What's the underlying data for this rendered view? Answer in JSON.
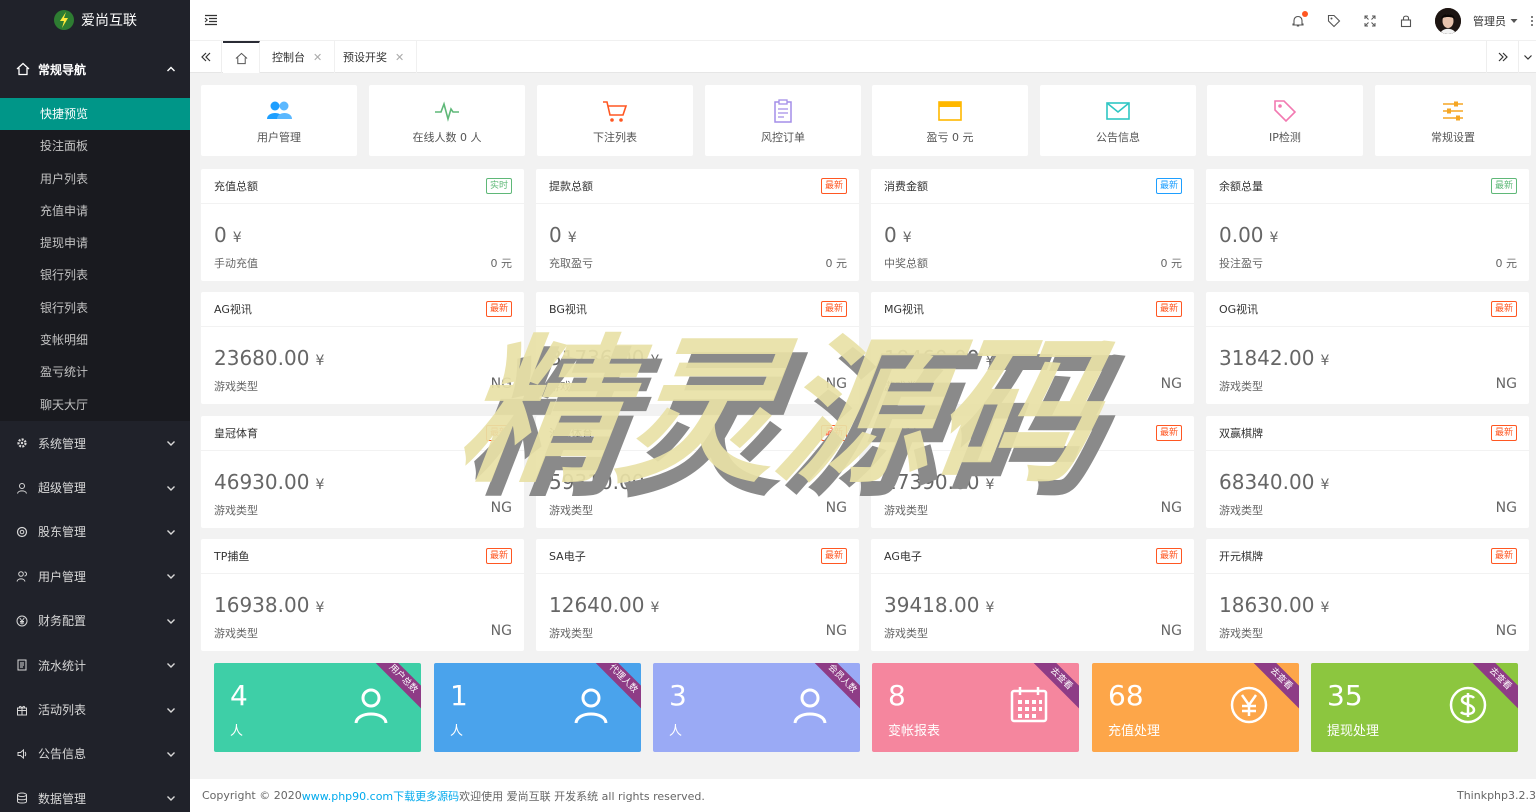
{
  "app": {
    "name": "爱尚互联"
  },
  "sidebar": {
    "group": {
      "label": "常规导航"
    },
    "items": [
      {
        "label": "快捷预览",
        "active": true
      },
      {
        "label": "投注面板"
      },
      {
        "label": "用户列表"
      },
      {
        "label": "充值申请"
      },
      {
        "label": "提现申请"
      },
      {
        "label": "银行列表"
      },
      {
        "label": "银行列表"
      },
      {
        "label": "变帐明细"
      },
      {
        "label": "盈亏统计"
      },
      {
        "label": "聊天大厅"
      }
    ],
    "categories": [
      {
        "label": "系统管理",
        "icon": "gear-icon"
      },
      {
        "label": "超级管理",
        "icon": "user-icon"
      },
      {
        "label": "股东管理",
        "icon": "settings-icon"
      },
      {
        "label": "用户管理",
        "icon": "users-icon"
      },
      {
        "label": "财务配置",
        "icon": "yen-icon"
      },
      {
        "label": "流水统计",
        "icon": "list-icon"
      },
      {
        "label": "活动列表",
        "icon": "gift-icon"
      },
      {
        "label": "公告信息",
        "icon": "speaker-icon"
      },
      {
        "label": "数据管理",
        "icon": "database-icon"
      }
    ]
  },
  "header": {
    "username": "管理员"
  },
  "tabs": [
    {
      "label": "控制台"
    },
    {
      "label": "预设开奖"
    }
  ],
  "quick": [
    {
      "label": "用户管理",
      "icon": "users-icon",
      "color": "#1e9fff"
    },
    {
      "label": "在线人数 0 人",
      "icon": "pulse-icon",
      "color": "#5fb878"
    },
    {
      "label": "下注列表",
      "icon": "cart-icon",
      "color": "#ff5722"
    },
    {
      "label": "风控订单",
      "icon": "clipboard-icon",
      "color": "#a48ee8"
    },
    {
      "label": "盈亏 0 元",
      "icon": "window-icon",
      "color": "#ffb800"
    },
    {
      "label": "公告信息",
      "icon": "mail-icon",
      "color": "#2fc6c3"
    },
    {
      "label": "IP检测",
      "icon": "tag-icon",
      "color": "#f279b1"
    },
    {
      "label": "常规设置",
      "icon": "sliders-icon",
      "color": "#f5a623"
    }
  ],
  "stats": [
    {
      "title": "充值总额",
      "badge": "实时",
      "badge_color": "green",
      "value": "0",
      "unit": "¥",
      "sub_label": "手动充值",
      "sub_value": "0 元"
    },
    {
      "title": "提款总额",
      "badge": "最新",
      "badge_color": "red",
      "value": "0",
      "unit": "¥",
      "sub_label": "充取盈亏",
      "sub_value": "0 元"
    },
    {
      "title": "消费金额",
      "badge": "最新",
      "badge_color": "blue",
      "value": "0",
      "unit": "¥",
      "sub_label": "中奖总额",
      "sub_value": "0 元"
    },
    {
      "title": "余额总量",
      "badge": "最新",
      "badge_color": "green",
      "value": "0.00",
      "unit": "¥",
      "sub_label": "投注盈亏",
      "sub_value": "0 元"
    },
    {
      "title": "AG视讯",
      "badge": "最新",
      "badge_color": "red",
      "value": "23680.00",
      "unit": "¥",
      "sub_label": "游戏类型",
      "sub_value": "NG"
    },
    {
      "title": "BG视讯",
      "badge": "最新",
      "badge_color": "red",
      "value": "31736.00",
      "unit": "¥",
      "sub_label": "游戏类型",
      "sub_value": "NG"
    },
    {
      "title": "MG视讯",
      "badge": "最新",
      "badge_color": "red",
      "value": "19460.00",
      "unit": "¥",
      "sub_label": "游戏类型",
      "sub_value": "NG"
    },
    {
      "title": "OG视讯",
      "badge": "最新",
      "badge_color": "red",
      "value": "31842.00",
      "unit": "¥",
      "sub_label": "游戏类型",
      "sub_value": "NG"
    },
    {
      "title": "皇冠体育",
      "badge": "最新",
      "badge_color": "red",
      "value": "46930.00",
      "unit": "¥",
      "sub_label": "游戏类型",
      "sub_value": "NG"
    },
    {
      "title": "沙巴体育",
      "badge": "最新",
      "badge_color": "red",
      "value": "59310.00",
      "unit": "¥",
      "sub_label": "游戏类型",
      "sub_value": "NG"
    },
    {
      "title": "AG捕鱼",
      "badge": "最新",
      "badge_color": "red",
      "value": "27390.00",
      "unit": "¥",
      "sub_label": "游戏类型",
      "sub_value": "NG"
    },
    {
      "title": "双赢棋牌",
      "badge": "最新",
      "badge_color": "red",
      "value": "68340.00",
      "unit": "¥",
      "sub_label": "游戏类型",
      "sub_value": "NG"
    },
    {
      "title": "TP捕鱼",
      "badge": "最新",
      "badge_color": "red",
      "value": "16938.00",
      "unit": "¥",
      "sub_label": "游戏类型",
      "sub_value": "NG"
    },
    {
      "title": "SA电子",
      "badge": "最新",
      "badge_color": "red",
      "value": "12640.00",
      "unit": "¥",
      "sub_label": "游戏类型",
      "sub_value": "NG"
    },
    {
      "title": "AG电子",
      "badge": "最新",
      "badge_color": "red",
      "value": "39418.00",
      "unit": "¥",
      "sub_label": "游戏类型",
      "sub_value": "NG"
    },
    {
      "title": "开元棋牌",
      "badge": "最新",
      "badge_color": "red",
      "value": "18630.00",
      "unit": "¥",
      "sub_label": "游戏类型",
      "sub_value": "NG"
    }
  ],
  "tiles": [
    {
      "number": "4",
      "label": "人",
      "ribbon": "用户总数",
      "icon": "user-icon",
      "color": "#3ecfa7"
    },
    {
      "number": "1",
      "label": "人",
      "ribbon": "代理人数",
      "icon": "user-icon",
      "color": "#4aa3ec"
    },
    {
      "number": "3",
      "label": "人",
      "ribbon": "会员人数",
      "icon": "user-icon",
      "color": "#9aaaf5"
    },
    {
      "number": "8",
      "label": "变帐报表",
      "ribbon": "去查看",
      "icon": "calendar-icon",
      "color": "#f5869e"
    },
    {
      "number": "68",
      "label": "充值处理",
      "ribbon": "去查看",
      "icon": "yen-circle-icon",
      "color": "#fda649"
    },
    {
      "number": "35",
      "label": "提现处理",
      "ribbon": "去查看",
      "icon": "dollar-circle-icon",
      "color": "#8cc63f"
    }
  ],
  "footer": {
    "copyright": "Copyright © 2020 ",
    "link": "www.php90.com下载更多源码",
    "rest": " 欢迎使用 爱尚互联 开发系统 all rights reserved.",
    "version": "Thinkphp3.2.3"
  },
  "watermark": {
    "text": "精灵源码"
  }
}
